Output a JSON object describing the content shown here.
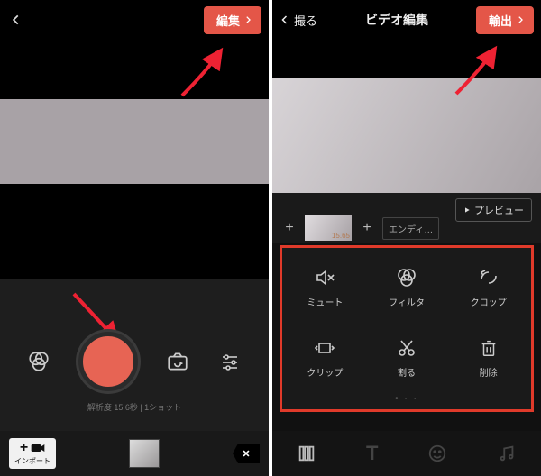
{
  "left": {
    "edit_label": "編集",
    "shot_info": "解析度 15.6秒 | 1ショット",
    "import_label": "インポート"
  },
  "right": {
    "back_label": "撮る",
    "title": "ビデオ編集",
    "export_label": "輸出",
    "preview_label": "プレビュー",
    "clip_duration": "15.65",
    "ending_label": "エンディ…",
    "tools": {
      "mute": "ミュート",
      "filter": "フィルタ",
      "crop": "クロップ",
      "clip": "クリップ",
      "cut": "割る",
      "delete": "削除"
    }
  }
}
